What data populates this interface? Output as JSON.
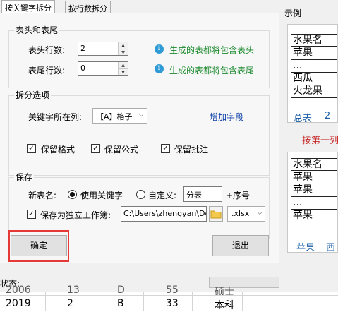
{
  "tabs": [
    "按关键字拆分",
    "按行数拆分"
  ],
  "header_footer": {
    "title": "表头和表尾",
    "header_rows_label": "表头行数:",
    "header_rows_value": "2",
    "header_hint": "生成的表都将包含表头",
    "footer_rows_label": "表尾行数:",
    "footer_rows_value": "0",
    "footer_hint": "生成的表都将包含表尾"
  },
  "split_options": {
    "title": "拆分选项",
    "keyword_column_label": "关键字所在列:",
    "keyword_column_value": "【A】格子",
    "add_field_link": "增加字段",
    "checkboxes": [
      "保留格式",
      "保留公式",
      "保留批注"
    ]
  },
  "save": {
    "title": "保存",
    "new_name_label": "新表名:",
    "radio_keyword": "使用关键字",
    "radio_custom": "自定义:",
    "custom_value": "分表",
    "suffix_label": "+序号",
    "save_independent_label": "保存为独立工作簿:",
    "path_value": "C:\\Users\\zhengyan\\De",
    "extension_value": ".xlsx"
  },
  "buttons": {
    "ok": "确定",
    "exit": "退出"
  },
  "preview": {
    "title": "示例",
    "table1": [
      "水果名",
      "苹果",
      "...",
      "西瓜",
      "火龙果"
    ],
    "table1_tabs": [
      "总表",
      "2"
    ],
    "caption": "按第一列",
    "table2": [
      "水果名",
      "苹果",
      "苹果",
      "...",
      "苹果"
    ],
    "table2_tabs": [
      "苹果",
      "西"
    ]
  },
  "status": {
    "label": "状态:"
  },
  "sheet": {
    "row_partial": [
      "2006",
      "13",
      "D",
      "55",
      "硕士"
    ],
    "row": [
      "2019",
      "2",
      "B",
      "33",
      "本科"
    ]
  },
  "colors": {
    "hint_green": "#1b8a2e",
    "link_blue": "#0b3fa8",
    "highlight_red": "#e53935",
    "caption_red": "#c62828"
  }
}
